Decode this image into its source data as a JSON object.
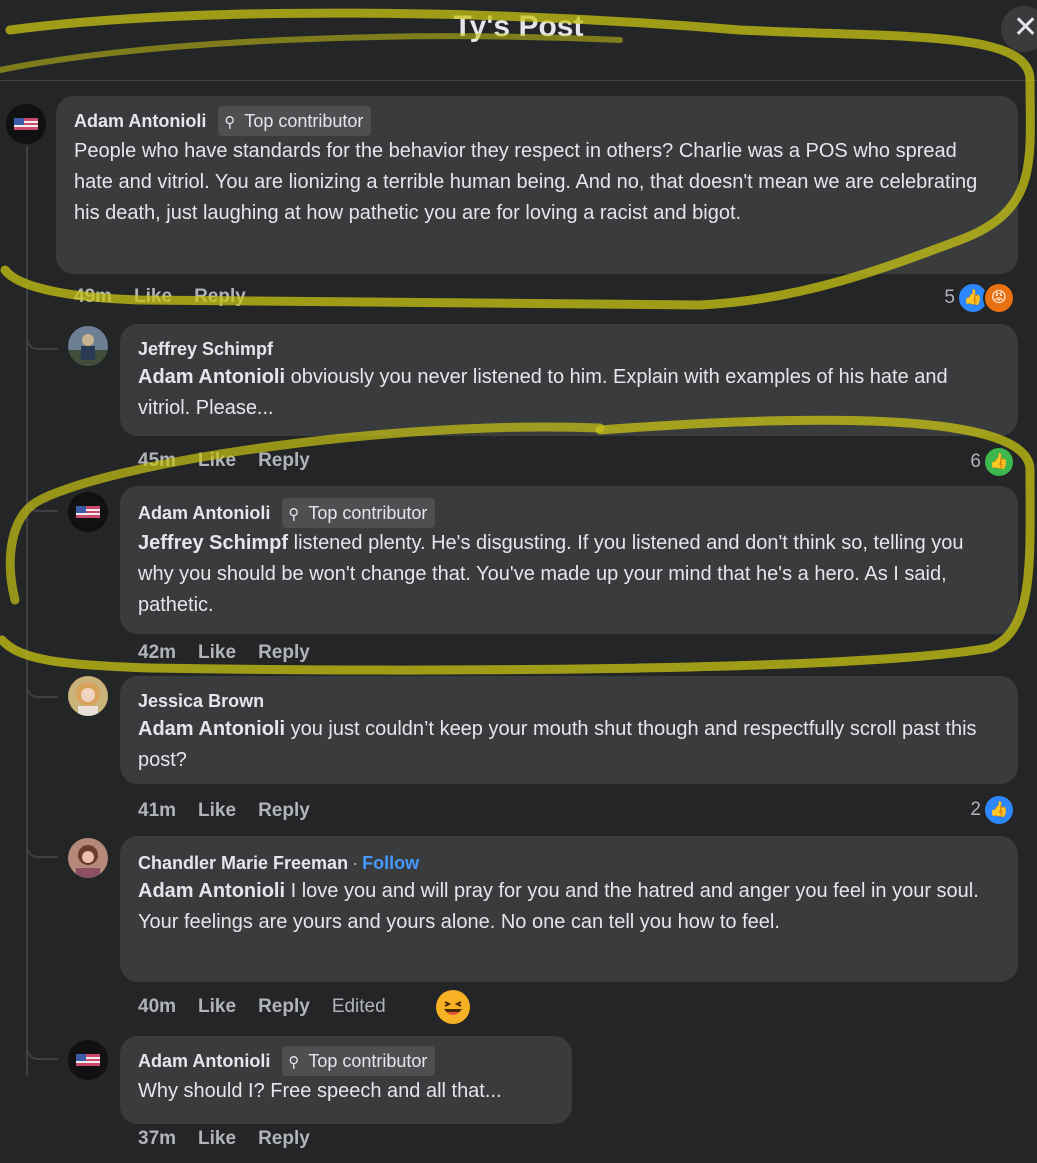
{
  "header": {
    "title": "Ty's Post",
    "close_glyph": "✕"
  },
  "badge_icon": "⚲",
  "comments": [
    {
      "author": "Adam Antonioli",
      "badge": "Top contributor",
      "text": "People who have standards for the behavior they respect in others? Charlie was a POS who spread hate and vitriol. You are lionizing a terrible human being. And no, that doesn't mean we are celebrating his death, just laughing at how pathetic you are for loving a racist and bigot.",
      "time": "49m",
      "like": "Like",
      "reply": "Reply",
      "reaction_count": "5",
      "reactions": [
        "like",
        "angry"
      ]
    },
    {
      "author": "Jeffrey Schimpf",
      "mention": "Adam Antonioli",
      "text": " obviously you never listened to him. Explain with examples of his hate and vitriol. Please...",
      "time": "45m",
      "like": "Like",
      "reply": "Reply",
      "reaction_count": "6",
      "reactions": [
        "like"
      ]
    },
    {
      "author": "Adam Antonioli",
      "badge": "Top contributor",
      "mention": "Jeffrey Schimpf",
      "text": " listened plenty. He's disgusting. If you listened and don't think so, telling you why you should be won't change that. You've made up your mind that he's a hero. As I said, pathetic.",
      "time": "42m",
      "like": "Like",
      "reply": "Reply"
    },
    {
      "author": "Jessica Brown",
      "mention": "Adam Antonioli",
      "text": " you just couldn’t keep your mouth shut though and respectfully scroll past this post?",
      "time": "41m",
      "like": "Like",
      "reply": "Reply",
      "reaction_count": "2",
      "reactions": [
        "like"
      ]
    },
    {
      "author": "Chandler Marie Freeman",
      "separator": "·",
      "follow": "Follow",
      "mention": "Adam Antonioli",
      "text": " I love you and will pray for you and the hatred and anger you feel in your soul. Your feelings are yours and yours alone. No one can tell you how to feel.",
      "time": "40m",
      "like": "Like",
      "reply": "Reply",
      "edited": "Edited",
      "emoji": "laughing-face"
    },
    {
      "author": "Adam Antonioli",
      "badge": "Top contributor",
      "text": "Why should I? Free speech and all that...",
      "time": "37m",
      "like": "Like",
      "reply": "Reply"
    }
  ],
  "colors": {
    "background": "#242526",
    "bubble": "#3a3b3c",
    "text": "#e4e6eb",
    "meta": "#b0b3b8",
    "link": "#4599ff",
    "like": "#2d88ff",
    "angry": "#e9710f",
    "highlighter": "#c8c414"
  }
}
